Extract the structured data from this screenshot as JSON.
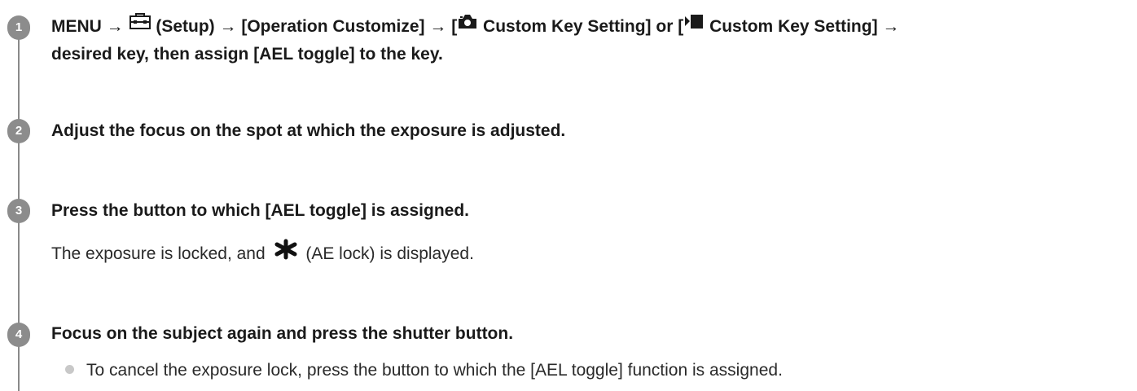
{
  "steps": [
    {
      "number": "1",
      "line1_part1": "MENU →",
      "setup_icon": "setup-toolbox-icon",
      "line1_part2": "(Setup) → [Operation Customize] → [",
      "still_icon": "camera-still-icon",
      "line1_part3": "Custom Key Setting] or [",
      "movie_icon": "movie-icon",
      "line1_part4": "Custom Key Setting] →",
      "line2": "desired key, then assign [AEL toggle] to the key."
    },
    {
      "number": "2",
      "title": "Adjust the focus on the spot at which the exposure is adjusted."
    },
    {
      "number": "3",
      "title": "Press the button to which [AEL toggle] is assigned.",
      "note_part1": "The exposure is locked, and",
      "ae_lock_icon": "ae-lock-asterisk-icon",
      "note_part2": "(AE lock) is displayed."
    },
    {
      "number": "4",
      "title": "Focus on the subject again and press the shutter button.",
      "bullets": [
        "To cancel the exposure lock, press the button to which the [AEL toggle] function is assigned."
      ]
    }
  ]
}
